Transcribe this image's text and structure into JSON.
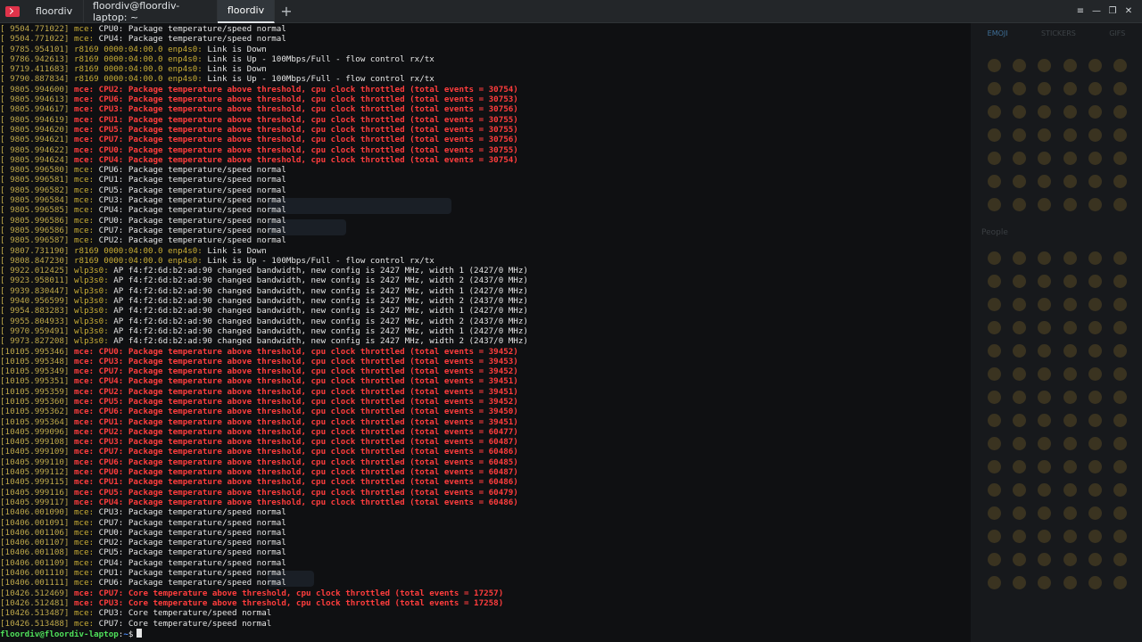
{
  "window": {
    "tabs": [
      {
        "label": "floordiv",
        "active": false
      },
      {
        "label": "floordiv@floordiv-laptop: ~",
        "active": false
      },
      {
        "label": "floordiv",
        "active": true
      }
    ],
    "accent_color": "#e0334a"
  },
  "terminal": {
    "lines": [
      {
        "ts": "[ 9504.771022]",
        "src": "mce:",
        "msg": " CPU0: Package temperature/speed normal",
        "alert": false
      },
      {
        "ts": "[ 9504.771022]",
        "src": "mce:",
        "msg": " CPU4: Package temperature/speed normal",
        "alert": false
      },
      {
        "ts": "[ 9785.954101]",
        "src": "r8169 0000:04:00.0 enp4s0:",
        "msg": " Link is Down",
        "alert": false
      },
      {
        "ts": "[ 9786.942613]",
        "src": "r8169 0000:04:00.0 enp4s0:",
        "msg": " Link is Up - 100Mbps/Full - flow control rx/tx",
        "alert": false
      },
      {
        "ts": "[ 9719.411683]",
        "src": "r8169 0000:04:00.0 enp4s0:",
        "msg": " Link is Down",
        "alert": false
      },
      {
        "ts": "[ 9790.887834]",
        "src": "r8169 0000:04:00.0 enp4s0:",
        "msg": " Link is Up - 100Mbps/Full - flow control rx/tx",
        "alert": false
      },
      {
        "ts": "[ 9805.994600]",
        "src": "mce:",
        "msg": " CPU2: Package temperature above threshold, cpu clock throttled (total events = 30754)",
        "alert": true
      },
      {
        "ts": "[ 9805.994613]",
        "src": "mce:",
        "msg": " CPU6: Package temperature above threshold, cpu clock throttled (total events = 30753)",
        "alert": true
      },
      {
        "ts": "[ 9805.994617]",
        "src": "mce:",
        "msg": " CPU3: Package temperature above threshold, cpu clock throttled (total events = 30756)",
        "alert": true
      },
      {
        "ts": "[ 9805.994619]",
        "src": "mce:",
        "msg": " CPU1: Package temperature above threshold, cpu clock throttled (total events = 30755)",
        "alert": true
      },
      {
        "ts": "[ 9805.994620]",
        "src": "mce:",
        "msg": " CPU5: Package temperature above threshold, cpu clock throttled (total events = 30755)",
        "alert": true
      },
      {
        "ts": "[ 9805.994621]",
        "src": "mce:",
        "msg": " CPU7: Package temperature above threshold, cpu clock throttled (total events = 30756)",
        "alert": true
      },
      {
        "ts": "[ 9805.994622]",
        "src": "mce:",
        "msg": " CPU0: Package temperature above threshold, cpu clock throttled (total events = 30755)",
        "alert": true
      },
      {
        "ts": "[ 9805.994624]",
        "src": "mce:",
        "msg": " CPU4: Package temperature above threshold, cpu clock throttled (total events = 30754)",
        "alert": true
      },
      {
        "ts": "[ 9805.996580]",
        "src": "mce:",
        "msg": " CPU6: Package temperature/speed normal",
        "alert": false
      },
      {
        "ts": "[ 9805.996581]",
        "src": "mce:",
        "msg": " CPU1: Package temperature/speed normal",
        "alert": false
      },
      {
        "ts": "[ 9805.996582]",
        "src": "mce:",
        "msg": " CPU5: Package temperature/speed normal",
        "alert": false
      },
      {
        "ts": "[ 9805.996584]",
        "src": "mce:",
        "msg": " CPU3: Package temperature/speed normal",
        "alert": false
      },
      {
        "ts": "[ 9805.996585]",
        "src": "mce:",
        "msg": " CPU4: Package temperature/speed normal",
        "alert": false
      },
      {
        "ts": "[ 9805.996586]",
        "src": "mce:",
        "msg": " CPU0: Package temperature/speed normal",
        "alert": false
      },
      {
        "ts": "[ 9805.996586]",
        "src": "mce:",
        "msg": " CPU7: Package temperature/speed normal",
        "alert": false
      },
      {
        "ts": "[ 9805.996587]",
        "src": "mce:",
        "msg": " CPU2: Package temperature/speed normal",
        "alert": false
      },
      {
        "ts": "[ 9807.731190]",
        "src": "r8169 0000:04:00.0 enp4s0:",
        "msg": " Link is Down",
        "alert": false
      },
      {
        "ts": "[ 9808.847230]",
        "src": "r8169 0000:04:00.0 enp4s0:",
        "msg": " Link is Up - 100Mbps/Full - flow control rx/tx",
        "alert": false
      },
      {
        "ts": "[ 9922.012425]",
        "src": "wlp3s0:",
        "msg": " AP f4:f2:6d:b2:ad:90 changed bandwidth, new config is 2427 MHz, width 1 (2427/0 MHz)",
        "alert": false
      },
      {
        "ts": "[ 9923.958011]",
        "src": "wlp3s0:",
        "msg": " AP f4:f2:6d:b2:ad:90 changed bandwidth, new config is 2427 MHz, width 2 (2437/0 MHz)",
        "alert": false
      },
      {
        "ts": "[ 9939.830447]",
        "src": "wlp3s0:",
        "msg": " AP f4:f2:6d:b2:ad:90 changed bandwidth, new config is 2427 MHz, width 1 (2427/0 MHz)",
        "alert": false
      },
      {
        "ts": "[ 9940.956599]",
        "src": "wlp3s0:",
        "msg": " AP f4:f2:6d:b2:ad:90 changed bandwidth, new config is 2427 MHz, width 2 (2437/0 MHz)",
        "alert": false
      },
      {
        "ts": "[ 9954.883283]",
        "src": "wlp3s0:",
        "msg": " AP f4:f2:6d:b2:ad:90 changed bandwidth, new config is 2427 MHz, width 1 (2427/0 MHz)",
        "alert": false
      },
      {
        "ts": "[ 9955.804933]",
        "src": "wlp3s0:",
        "msg": " AP f4:f2:6d:b2:ad:90 changed bandwidth, new config is 2427 MHz, width 2 (2437/0 MHz)",
        "alert": false
      },
      {
        "ts": "[ 9970.959491]",
        "src": "wlp3s0:",
        "msg": " AP f4:f2:6d:b2:ad:90 changed bandwidth, new config is 2427 MHz, width 1 (2427/0 MHz)",
        "alert": false
      },
      {
        "ts": "[ 9973.827208]",
        "src": "wlp3s0:",
        "msg": " AP f4:f2:6d:b2:ad:90 changed bandwidth, new config is 2427 MHz, width 2 (2437/0 MHz)",
        "alert": false
      },
      {
        "ts": "[10105.995346]",
        "src": "mce:",
        "msg": " CPU0: Package temperature above threshold, cpu clock throttled (total events = 39452)",
        "alert": true
      },
      {
        "ts": "[10105.995348]",
        "src": "mce:",
        "msg": " CPU3: Package temperature above threshold, cpu clock throttled (total events = 39453)",
        "alert": true
      },
      {
        "ts": "[10105.995349]",
        "src": "mce:",
        "msg": " CPU7: Package temperature above threshold, cpu clock throttled (total events = 39452)",
        "alert": true
      },
      {
        "ts": "[10105.995351]",
        "src": "mce:",
        "msg": " CPU4: Package temperature above threshold, cpu clock throttled (total events = 39451)",
        "alert": true
      },
      {
        "ts": "[10105.995359]",
        "src": "mce:",
        "msg": " CPU2: Package temperature above threshold, cpu clock throttled (total events = 39451)",
        "alert": true
      },
      {
        "ts": "[10105.995360]",
        "src": "mce:",
        "msg": " CPU5: Package temperature above threshold, cpu clock throttled (total events = 39452)",
        "alert": true
      },
      {
        "ts": "[10105.995362]",
        "src": "mce:",
        "msg": " CPU6: Package temperature above threshold, cpu clock throttled (total events = 39450)",
        "alert": true
      },
      {
        "ts": "[10105.995364]",
        "src": "mce:",
        "msg": " CPU1: Package temperature above threshold, cpu clock throttled (total events = 39451)",
        "alert": true
      },
      {
        "ts": "[10405.999096]",
        "src": "mce:",
        "msg": " CPU2: Package temperature above threshold, cpu clock throttled (total events = 60477)",
        "alert": true
      },
      {
        "ts": "[10405.999108]",
        "src": "mce:",
        "msg": " CPU3: Package temperature above threshold, cpu clock throttled (total events = 60487)",
        "alert": true
      },
      {
        "ts": "[10405.999109]",
        "src": "mce:",
        "msg": " CPU7: Package temperature above threshold, cpu clock throttled (total events = 60486)",
        "alert": true
      },
      {
        "ts": "[10405.999110]",
        "src": "mce:",
        "msg": " CPU6: Package temperature above threshold, cpu clock throttled (total events = 60485)",
        "alert": true
      },
      {
        "ts": "[10405.999112]",
        "src": "mce:",
        "msg": " CPU0: Package temperature above threshold, cpu clock throttled (total events = 60487)",
        "alert": true
      },
      {
        "ts": "[10405.999115]",
        "src": "mce:",
        "msg": " CPU1: Package temperature above threshold, cpu clock throttled (total events = 60486)",
        "alert": true
      },
      {
        "ts": "[10405.999116]",
        "src": "mce:",
        "msg": " CPU5: Package temperature above threshold, cpu clock throttled (total events = 60479)",
        "alert": true
      },
      {
        "ts": "[10405.999117]",
        "src": "mce:",
        "msg": " CPU4: Package temperature above threshold, cpu clock throttled (total events = 60486)",
        "alert": true
      },
      {
        "ts": "[10406.001090]",
        "src": "mce:",
        "msg": " CPU3: Package temperature/speed normal",
        "alert": false
      },
      {
        "ts": "[10406.001091]",
        "src": "mce:",
        "msg": " CPU7: Package temperature/speed normal",
        "alert": false
      },
      {
        "ts": "[10406.001106]",
        "src": "mce:",
        "msg": " CPU0: Package temperature/speed normal",
        "alert": false
      },
      {
        "ts": "[10406.001107]",
        "src": "mce:",
        "msg": " CPU2: Package temperature/speed normal",
        "alert": false
      },
      {
        "ts": "[10406.001108]",
        "src": "mce:",
        "msg": " CPU5: Package temperature/speed normal",
        "alert": false
      },
      {
        "ts": "[10406.001109]",
        "src": "mce:",
        "msg": " CPU4: Package temperature/speed normal",
        "alert": false
      },
      {
        "ts": "[10406.001110]",
        "src": "mce:",
        "msg": " CPU1: Package temperature/speed normal",
        "alert": false
      },
      {
        "ts": "[10406.001111]",
        "src": "mce:",
        "msg": " CPU6: Package temperature/speed normal",
        "alert": false
      },
      {
        "ts": "[10426.512469]",
        "src": "mce:",
        "msg": " CPU7: Core temperature above threshold, cpu clock throttled (total events = 17257)",
        "alert": true
      },
      {
        "ts": "[10426.512481]",
        "src": "mce:",
        "msg": " CPU3: Core temperature above threshold, cpu clock throttled (total events = 17258)",
        "alert": true
      },
      {
        "ts": "[10426.513487]",
        "src": "mce:",
        "msg": " CPU3: Core temperature/speed normal",
        "alert": false
      },
      {
        "ts": "[10426.513488]",
        "src": "mce:",
        "msg": " CPU7: Core temperature/speed normal",
        "alert": false
      }
    ],
    "prompt": {
      "user_host": "floordiv@floordiv-laptop",
      "sep": ":",
      "path": "~",
      "symbol": "$"
    },
    "colors": {
      "timestamp": "#bfa84a",
      "alert": "#ff3d3d",
      "prompt_user": "#4fe05a",
      "prompt_path": "#4d8fff"
    }
  },
  "background_app": {
    "panel_tabs": [
      "EMOJI",
      "STICKERS",
      "GIFS"
    ],
    "section_label": "People"
  }
}
